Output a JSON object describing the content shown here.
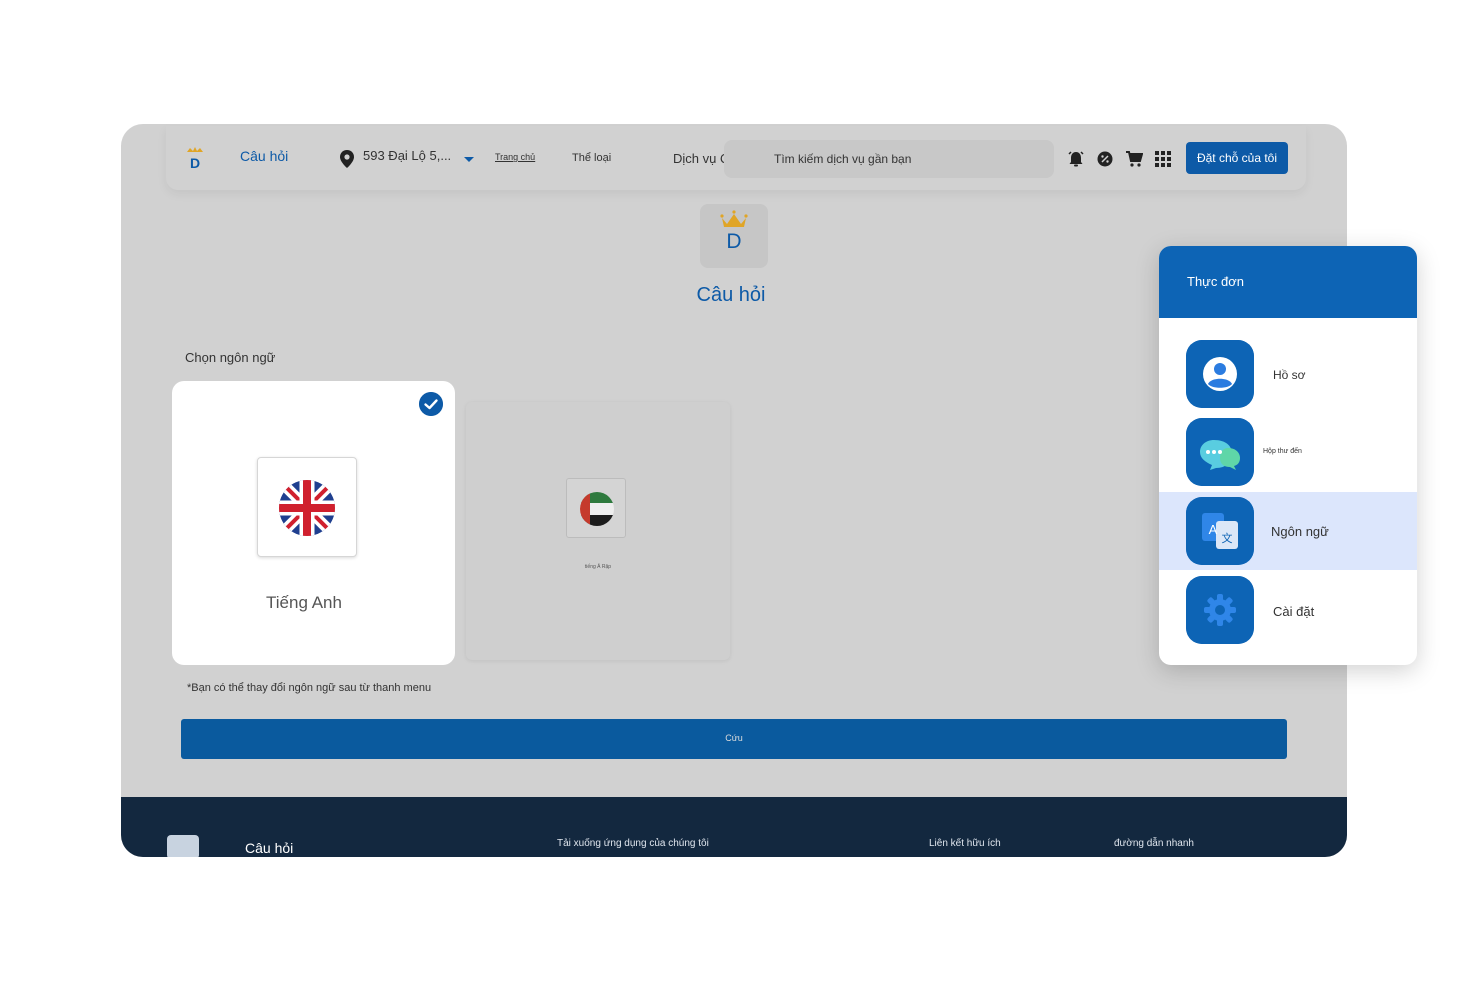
{
  "header": {
    "brand": "Câu hỏi",
    "address": "593 Đại Lộ 5,...",
    "nav_home": "Trang chủ",
    "nav_categories": "Thể loại",
    "nav_services": "Dịch vụ Q",
    "search_placeholder": "Tìm kiếm dịch vụ gần bạn",
    "book_button": "Đặt chỗ của tôi",
    "icons": [
      "alarm-icon",
      "discount-icon",
      "cart-icon",
      "grid-icon"
    ]
  },
  "main": {
    "logo_letter": "D",
    "title": "Câu hỏi",
    "choose_label": "Chọn ngôn ngữ",
    "languages": [
      {
        "name": "Tiếng Anh",
        "selected": true,
        "flag": "uk-flag-icon"
      },
      {
        "name": "tiếng Ả Rập",
        "selected": false,
        "flag": "uae-flag-icon"
      }
    ],
    "note": "*Bạn có thể thay đổi ngôn ngữ sau từ thanh menu",
    "save_button": "Cứu"
  },
  "footer": {
    "brand": "Câu hỏi",
    "download": "Tải xuống ứng dụng của chúng tôi",
    "links": "Liên kết hữu ích",
    "shortcuts": "đường dẫn nhanh"
  },
  "menu": {
    "title": "Thực đơn",
    "items": [
      {
        "label": "Hồ sơ",
        "icon": "profile-icon",
        "active": false
      },
      {
        "label": "Hộp thư đến",
        "icon": "chat-icon",
        "active": false
      },
      {
        "label": "Ngôn ngữ",
        "icon": "translate-icon",
        "active": true
      },
      {
        "label": "Cài đặt",
        "icon": "settings-icon",
        "active": false
      }
    ]
  },
  "colors": {
    "primary": "#0d5aa7",
    "menu_header": "#0d64b5",
    "active_row": "#dce6fc",
    "footer": "#13283f",
    "overlay": "#d1d1d1"
  }
}
